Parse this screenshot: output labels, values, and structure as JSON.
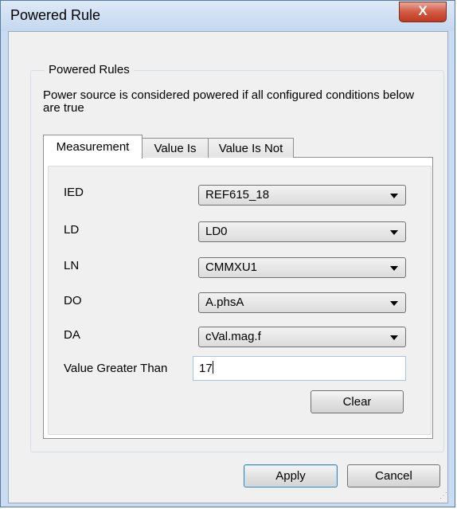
{
  "window": {
    "title": "Powered Rule",
    "close_glyph": "X"
  },
  "group": {
    "legend": "Powered Rules",
    "description": "Power source is considered powered if all configured conditions below are true"
  },
  "tabs": [
    {
      "label": "Measurement",
      "active": true
    },
    {
      "label": "Value Is",
      "active": false
    },
    {
      "label": "Value Is Not",
      "active": false
    }
  ],
  "fields": {
    "ied": {
      "label": "IED",
      "value": "REF615_18"
    },
    "ld": {
      "label": "LD",
      "value": "LD0"
    },
    "ln": {
      "label": "LN",
      "value": "CMMXU1"
    },
    "do": {
      "label": "DO",
      "value": "A.phsA"
    },
    "da": {
      "label": "DA",
      "value": "cVal.mag.f"
    },
    "threshold": {
      "label": "Value Greater Than",
      "value": "17"
    }
  },
  "buttons": {
    "clear": "Clear",
    "apply": "Apply",
    "cancel": "Cancel"
  }
}
